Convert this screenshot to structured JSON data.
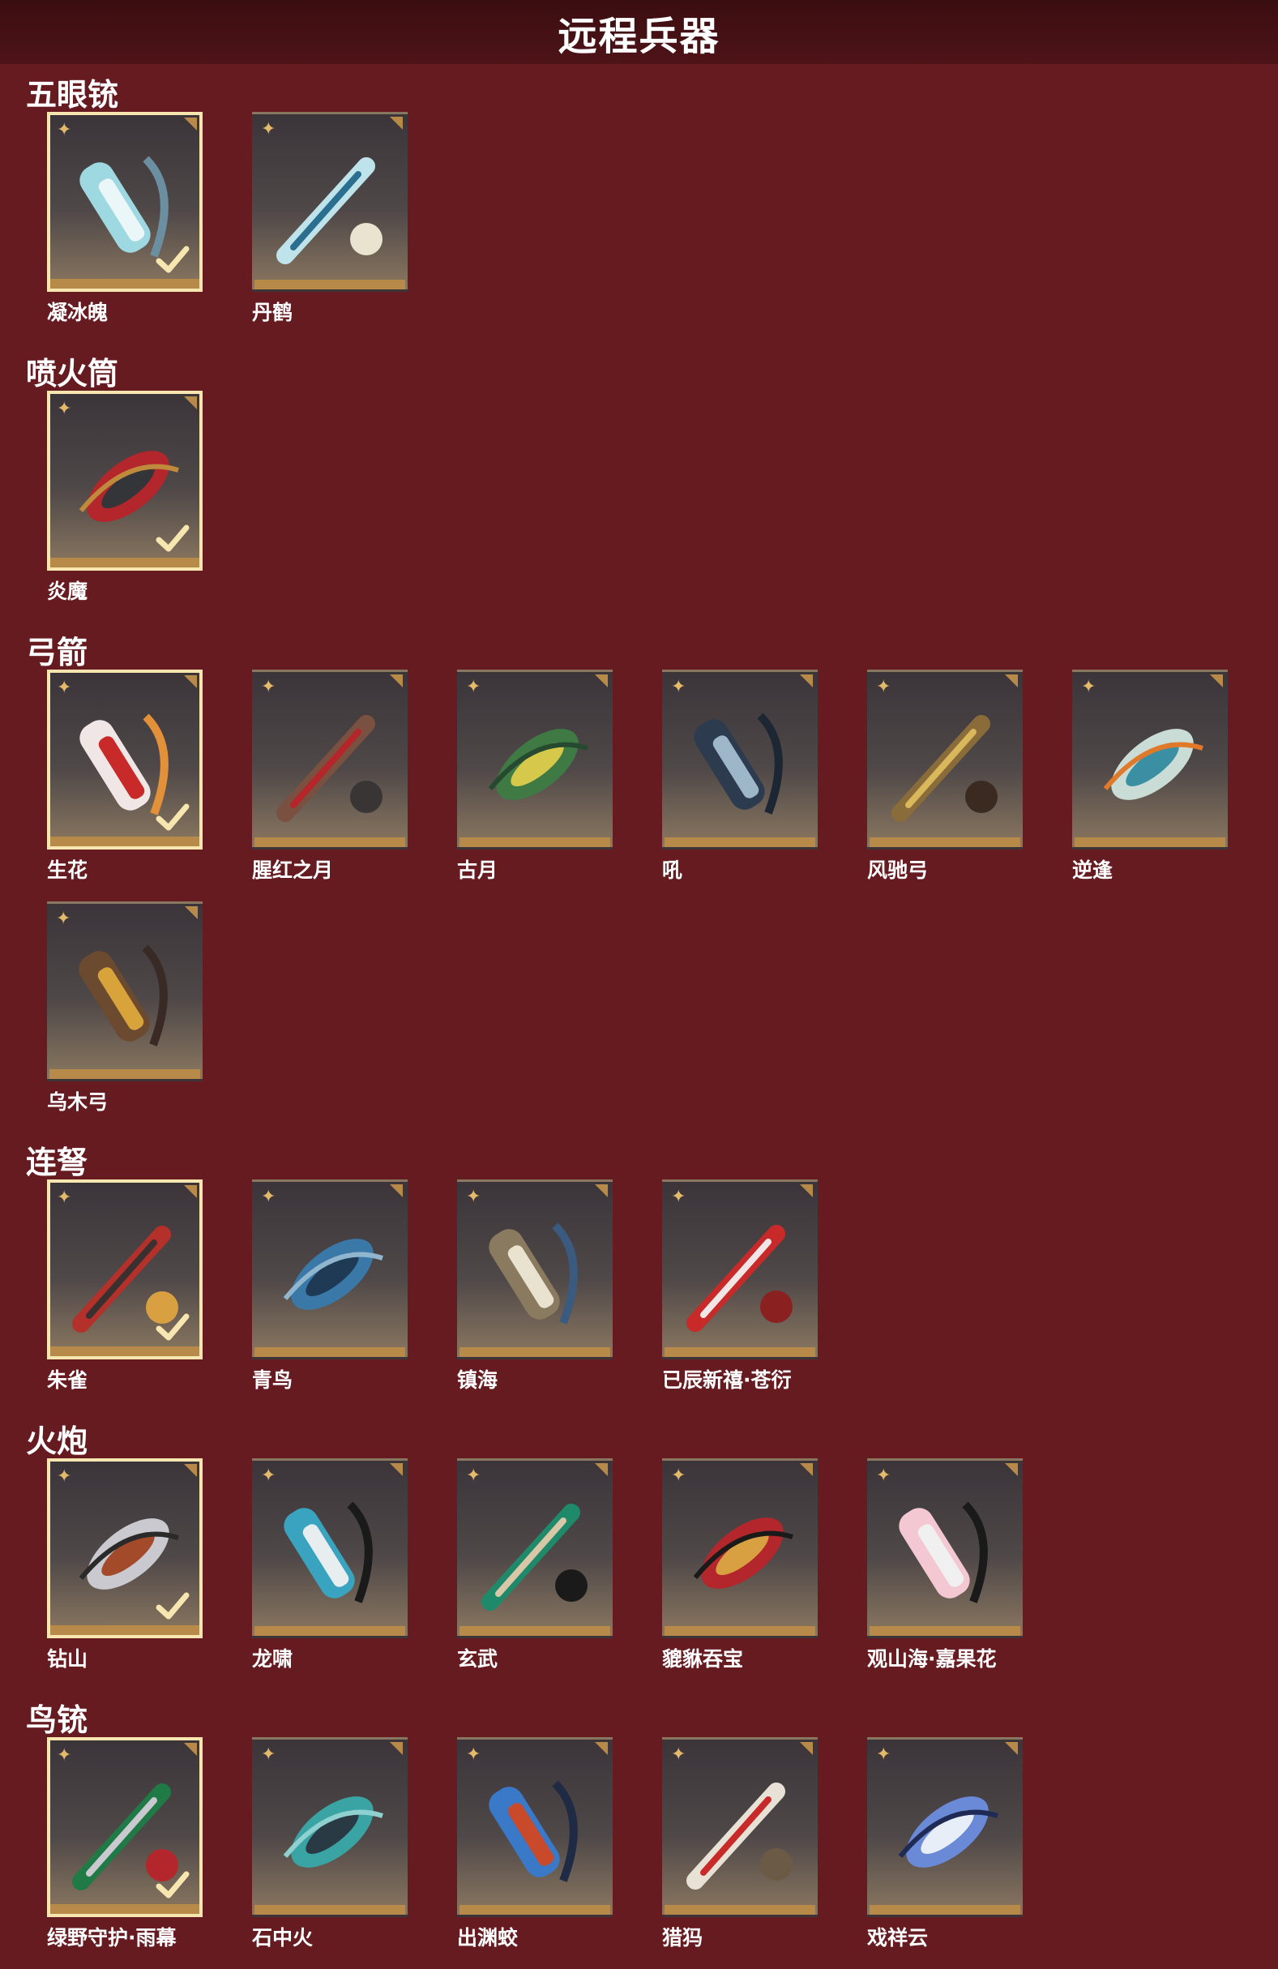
{
  "page": {
    "title": "远程兵器"
  },
  "sections": [
    {
      "title": "五眼铳",
      "items": [
        {
          "name": "凝冰魄",
          "selected": true,
          "colors": [
            "#9ed8e0",
            "#eaf6f7",
            "#6b8fa1"
          ]
        },
        {
          "name": "丹鹤",
          "selected": false,
          "colors": [
            "#bfe3ea",
            "#2a6f90",
            "#e9e3cf"
          ]
        }
      ]
    },
    {
      "title": "喷火筒",
      "items": [
        {
          "name": "炎魔",
          "selected": true,
          "colors": [
            "#b3262b",
            "#333538",
            "#c08a3c"
          ]
        }
      ]
    },
    {
      "title": "弓箭",
      "items": [
        {
          "name": "生花",
          "selected": true,
          "colors": [
            "#f0e6e6",
            "#c82a2a",
            "#e3903a"
          ]
        },
        {
          "name": "腥红之月",
          "selected": false,
          "colors": [
            "#7a5040",
            "#b5262a",
            "#3a3535"
          ]
        },
        {
          "name": "古月",
          "selected": false,
          "colors": [
            "#3f7a45",
            "#d6c84a",
            "#264a2f"
          ]
        },
        {
          "name": "吼",
          "selected": false,
          "colors": [
            "#2d3b4f",
            "#9db7c9",
            "#1d2633"
          ]
        },
        {
          "name": "风驰弓",
          "selected": false,
          "colors": [
            "#8a6b3a",
            "#d8b85a",
            "#3b2a20"
          ]
        },
        {
          "name": "逆逢",
          "selected": false,
          "colors": [
            "#c9ddd6",
            "#3a8fa3",
            "#e07a2a"
          ]
        },
        {
          "name": "乌木弓",
          "selected": false,
          "colors": [
            "#6b4a30",
            "#d8a33a",
            "#3a2a25"
          ]
        }
      ]
    },
    {
      "title": "连弩",
      "items": [
        {
          "name": "朱雀",
          "selected": true,
          "colors": [
            "#b3312a",
            "#3a3030",
            "#d8a040"
          ]
        },
        {
          "name": "青鸟",
          "selected": false,
          "colors": [
            "#3a78a8",
            "#1f3a55",
            "#8fb5cf"
          ]
        },
        {
          "name": "镇海",
          "selected": false,
          "colors": [
            "#8a7a60",
            "#e8e2cf",
            "#3a5a80"
          ]
        },
        {
          "name": "已辰新禧·苍衍",
          "selected": false,
          "colors": [
            "#c82a2a",
            "#f0e6e6",
            "#8a2020"
          ]
        }
      ]
    },
    {
      "title": "火炮",
      "items": [
        {
          "name": "钻山",
          "selected": true,
          "colors": [
            "#c9c9cf",
            "#a34a2a",
            "#2a2a2a"
          ]
        },
        {
          "name": "龙啸",
          "selected": false,
          "colors": [
            "#3aa3bf",
            "#e8eef0",
            "#1a1a1a"
          ]
        },
        {
          "name": "玄武",
          "selected": false,
          "colors": [
            "#1f8a6a",
            "#d8c8a8",
            "#1a1a1a"
          ]
        },
        {
          "name": "貔貅吞宝",
          "selected": false,
          "colors": [
            "#b3262b",
            "#d8a040",
            "#1a1a1a"
          ]
        },
        {
          "name": "观山海·嘉果花",
          "selected": false,
          "colors": [
            "#f4c8d2",
            "#f0f0f0",
            "#1a1a1a"
          ]
        }
      ]
    },
    {
      "title": "鸟铳",
      "items": [
        {
          "name": "绿野守护·雨幕",
          "selected": true,
          "colors": [
            "#1f7a45",
            "#c9c9cf",
            "#b3262b"
          ]
        },
        {
          "name": "石中火",
          "selected": false,
          "colors": [
            "#3aa3a3",
            "#2a3a45",
            "#8fd0d0"
          ]
        },
        {
          "name": "出渊蛟",
          "selected": false,
          "colors": [
            "#3a78c8",
            "#c84a2a",
            "#1f2a45"
          ]
        },
        {
          "name": "猎犸",
          "selected": false,
          "colors": [
            "#e8e2d6",
            "#c82a2a",
            "#6b5a45"
          ]
        },
        {
          "name": "戏祥云",
          "selected": false,
          "colors": [
            "#6a8ad8",
            "#e8eef8",
            "#1f2a55"
          ]
        }
      ]
    }
  ]
}
